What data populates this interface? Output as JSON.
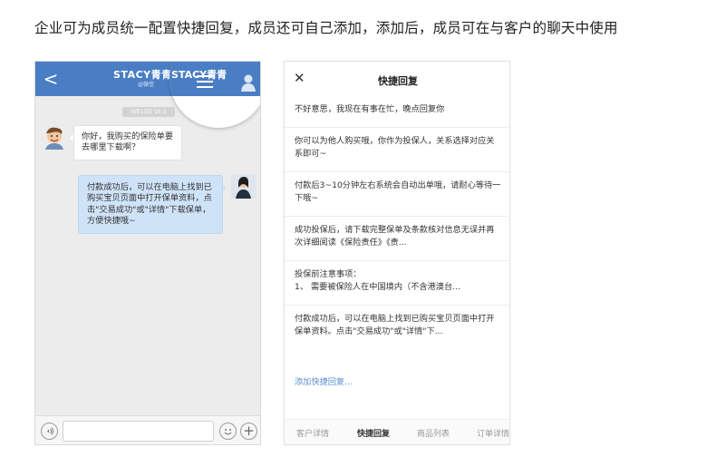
{
  "caption": "企业可为成员统一配置快捷回复，成员还可自己添加，添加后，成员可在与客户的聊天中使用",
  "chat": {
    "back_label": "<",
    "title": "STACY青青",
    "subtitle": "@微信",
    "timestamp": "9月13日 15:3",
    "messages": [
      {
        "side": "left",
        "text": "你好，我购买的保险单要去哪里下载啊？"
      },
      {
        "side": "right",
        "text": "付款成功后，可以在电脑上找到已购买宝贝页面中打开保单资料，点击\"交易成功\"或\"详情\"下载保单，方便快捷哦~"
      }
    ],
    "voice_icon": "voice-icon",
    "emoji_icon": "emoji-icon",
    "plus_label": "+"
  },
  "panel": {
    "close_label": "✕",
    "title": "快捷回复",
    "replies": [
      "不好意思，我现在有事在忙，晚点回复你",
      "你可以为他人购买哦，你作为投保人，关系选择对应关系即可~",
      "付款后3~10分钟左右系统会自动出单哦，请耐心等待一下哦~",
      "成功投保后，请下载完整保单及条款核对信息无误并再次详细阅读《保险责任》《责...",
      "投保前注意事项：\n1、 需要被保险人在中国境内（不含港澳台...",
      "付款成功后，可以在电脑上找到已购买宝贝页面中打开保单资料。点击\"交易成功\"或\"详情\"下..."
    ],
    "add_label": "添加快捷回复...",
    "tabs": [
      {
        "label": "客户详情",
        "active": false
      },
      {
        "label": "快捷回复",
        "active": true
      },
      {
        "label": "商品列表",
        "active": false
      },
      {
        "label": "订单详情",
        "active": false
      }
    ]
  },
  "colors": {
    "header_blue": "#4a7ec4",
    "bubble_blue": "#cfe3f8",
    "link_blue": "#5b8fd0"
  }
}
